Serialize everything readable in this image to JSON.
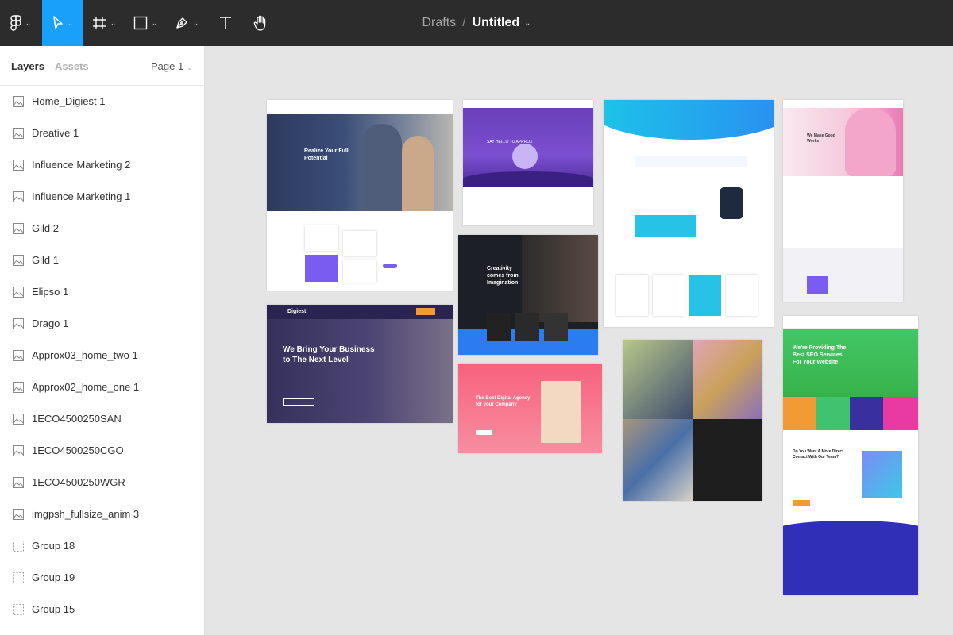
{
  "header": {
    "breadcrumb": "Drafts",
    "separator": "/",
    "title": "Untitled"
  },
  "toolbar": {
    "tools": [
      {
        "name": "main-menu",
        "icon": "figma-logo-icon"
      },
      {
        "name": "move-tool",
        "icon": "pointer-icon",
        "active": true
      },
      {
        "name": "frame-tool",
        "icon": "frame-hash-icon"
      },
      {
        "name": "shape-tool",
        "icon": "rectangle-icon"
      },
      {
        "name": "pen-tool",
        "icon": "pen-icon"
      },
      {
        "name": "text-tool",
        "icon": "text-t-icon"
      },
      {
        "name": "hand-tool",
        "icon": "hand-icon"
      }
    ],
    "active_color": "#18a0fb"
  },
  "sidebar": {
    "tabs": [
      "Layers",
      "Assets"
    ],
    "page": "Page 1",
    "layers": [
      {
        "name": "Home_Digiest 1",
        "type": "image"
      },
      {
        "name": "Dreative 1",
        "type": "image"
      },
      {
        "name": "Influence Marketing 2",
        "type": "image"
      },
      {
        "name": "Influence Marketing 1",
        "type": "image"
      },
      {
        "name": "Gild 2",
        "type": "image"
      },
      {
        "name": "Gild 1",
        "type": "image"
      },
      {
        "name": "Elipso 1",
        "type": "image"
      },
      {
        "name": "Drago 1",
        "type": "image"
      },
      {
        "name": "Approx03_home_two 1",
        "type": "image"
      },
      {
        "name": "Approx02_home_one 1",
        "type": "image"
      },
      {
        "name": "1ECO4500250SAN",
        "type": "image"
      },
      {
        "name": "1ECO4500250CGO",
        "type": "image"
      },
      {
        "name": "1ECO4500250WGR",
        "type": "image"
      },
      {
        "name": "imgpsh_fullsize_anim 3",
        "type": "image"
      },
      {
        "name": "Group 18",
        "type": "group"
      },
      {
        "name": "Group 19",
        "type": "group"
      },
      {
        "name": "Group 15",
        "type": "group"
      }
    ]
  },
  "canvas": {
    "frames": {
      "digiest_hero": "Realize Your Full Potential",
      "approx_hero": "SAY HELLO TO APPROX",
      "creativity_hero": "Creativity comes from Imagination",
      "digiest_logo": "Digiest",
      "digiest_business": "We Bring Your Business to The Next Level",
      "agency_hero": "The Best Digital Agency for your Company",
      "good_works": "We Make Good Works",
      "seo_hero": "We're Providing The Best SEO Services For Your Website",
      "seo_contact": "Do You Want A More Direct Contact With Our Team?"
    }
  }
}
